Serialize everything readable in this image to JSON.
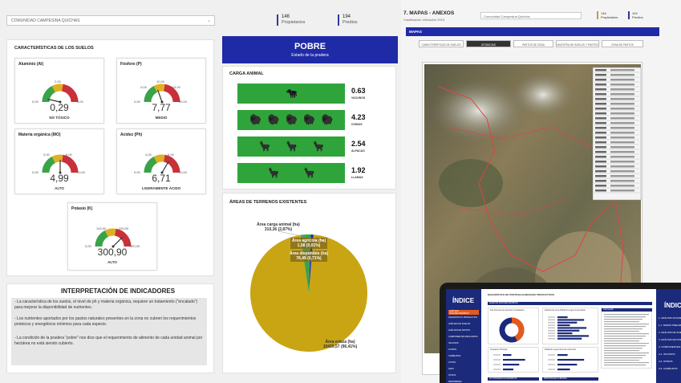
{
  "dashboard": {
    "community_select": "COMUNIDAD CAMPESINA QUICHAS",
    "kpis": [
      {
        "value": "146",
        "label": "Propietarios"
      },
      {
        "value": "194",
        "label": "Predios"
      }
    ],
    "soils_title": "CARACTERÍSTICAS DE LOS SUELOS",
    "gauges": [
      {
        "title": "Aluminio (Al)",
        "value": "0,29",
        "tag": "NO TÓXICO",
        "ticks": [
          "0,00",
          "2,00",
          "4,00"
        ],
        "fraction": 0.07
      },
      {
        "title": "Fósforo (P)",
        "value": "7,77",
        "tag": "MEDIO",
        "ticks": [
          "0,00",
          "5,00",
          "10,00",
          "15,00",
          "20,00"
        ],
        "fraction": 0.39
      },
      {
        "title": "Materia orgánica (MO)",
        "value": "4,99",
        "tag": "ALTO",
        "ticks": [
          "0,00",
          "3,00",
          "6,00",
          "10,00"
        ],
        "fraction": 0.5
      },
      {
        "title": "Acidez (Ph)",
        "value": "6,71",
        "tag": "LIGERAMENTE ÁCIDO",
        "ticks": [
          "0,00",
          "4,00",
          "6,00",
          "10,00"
        ],
        "fraction": 0.67
      },
      {
        "title": "Potasio (K)",
        "value": "300,90",
        "tag": "ALTO",
        "ticks": [
          "0,00",
          "100,00",
          "200,00",
          "400,00"
        ],
        "fraction": 0.75
      }
    ],
    "status": {
      "title": "POBRE",
      "subtitle": "Estado de la pradera"
    },
    "carga_title": "CARGA ANIMAL",
    "animals": [
      {
        "value": "0.63",
        "label": "VACUNOS",
        "icon": "cow-icon",
        "count": 1
      },
      {
        "value": "4.23",
        "label": "OVINOS",
        "icon": "sheep-icon",
        "count": 5
      },
      {
        "value": "2.54",
        "label": "ALPACAS",
        "icon": "alpaca-icon",
        "count": 3
      },
      {
        "value": "1.92",
        "label": "LLAMAS",
        "icon": "llama-icon",
        "count": 2
      }
    ],
    "areas_title": "ÁREAS DE TERRENOS EXISTENTES",
    "interp_title": "INTERPRETACIÓN DE INDICADORES",
    "interp_items": [
      "- La característica de los suelos, el nivel de ph y materia orgánica, requiere un tratamiento (\"encalado\") para mejorar la disponibilidad de nutrientes.",
      "- Los nutrientes aportados por los pastos naturales presentes en la zona no cubren los requerimientos proteicos y energéticos mínimos para cada especie.",
      "- La condición de la pradera \"pobre\" nos dice que el requerimiento de alimento de cada unidad animal por hectárea no está siendo cubierto."
    ]
  },
  "chart_data": {
    "type": "pie",
    "title": "ÁREAS DE TERRENOS EXISTENTES",
    "slices": [
      {
        "name": "Área eriaza (ha)",
        "value": 10439.57,
        "label": "10439,57 (96,41%)",
        "color": "#c9a514"
      },
      {
        "name": "Área carga animal (ha)",
        "value": 310.36,
        "label": "310,36 (2,87%)",
        "color": "#3aa34a"
      },
      {
        "name": "Área agrícola (ha)",
        "value": 1.58,
        "label": "1,58 (0,01%)",
        "color": "#7a4c1e"
      },
      {
        "name": "Área disponible (ha)",
        "value": 76.49,
        "label": "76,49 (0,71%)",
        "color": "#1f2aa6"
      }
    ]
  },
  "maps": {
    "title": "7. MAPAS - ANEXOS",
    "subtitle": "Clasificación Ubicación 2013",
    "select": "Comunidad Campesina Quichas",
    "kpis": [
      {
        "value": "146",
        "label": "Propietarios"
      },
      {
        "value": "194",
        "label": "Predios"
      }
    ],
    "section": "MAPAS",
    "tabs": [
      {
        "label": "CARACTERÍSTICAS DE SUELOS",
        "active": false
      },
      {
        "label": "ESTANCIAS",
        "active": true
      },
      {
        "label": "PASTOS DE ZONA",
        "active": false
      },
      {
        "label": "MUESTRA DE SUELOS Y PASTOS",
        "active": false
      },
      {
        "label": "ZONA DE PASTOS",
        "active": false
      }
    ]
  },
  "tablet": {
    "index_title": "ÍNDICE",
    "report_title": "DIAGNÓSTICO DE PORTES/CALIBRADOS PRODUCTIVOS",
    "index_items": [
      "ANÁLISIS SOCIOECONÓMICO",
      "DIAGNÓSTICO PRODUCTIVO",
      "ANÁLISIS DE SUELOS",
      "ANÁLISIS DE PASTOS",
      "COMPONENTES PECUARIOS",
      "VACUNOS",
      "OVINOS",
      "CAMÉLIDOS",
      "CUYES",
      "AVES",
      "OTROS",
      "RESÚMENES"
    ],
    "right_index": [
      "1. ANÁLISIS SOCIOECO",
      "1.1. MAPAS PRELIM",
      "2. ANÁLISIS DE SUEL",
      "3. ANÁLISIS DE PAST",
      "4. COMPONENTES P",
      "4.1. VACUNOS",
      "4.2. OVINOS",
      "4.3. CAMÉLIDOS"
    ],
    "panels": [
      "Sub Gerencia de Atención al Ciudadano",
      "Distribución de la Población según Grupo Etario",
      "Información",
      "Ocupación Principal",
      "Población según Nivel de Instrucción",
      "ACTIVIDADES ECONÓMICAS",
      "PRINCIPALES FUENTES"
    ]
  }
}
